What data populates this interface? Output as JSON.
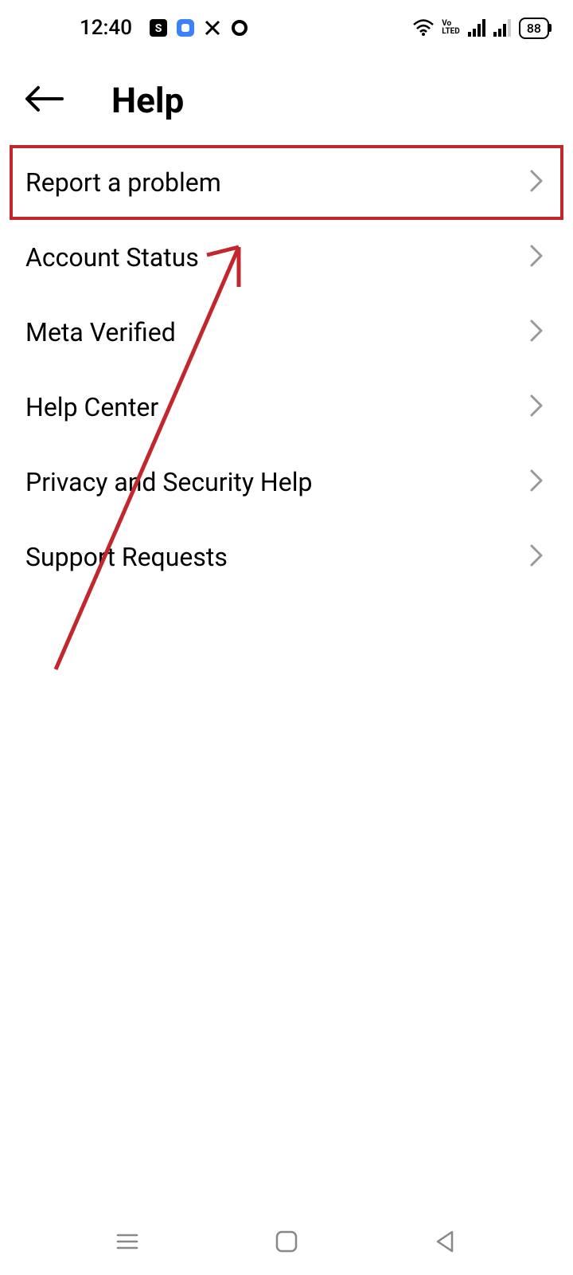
{
  "status_bar": {
    "time": "12:40",
    "battery": "88",
    "volte": "Vo\nLTED"
  },
  "header": {
    "title": "Help"
  },
  "menu": {
    "items": [
      {
        "label": "Report a problem",
        "highlighted": true
      },
      {
        "label": "Account Status",
        "highlighted": false
      },
      {
        "label": "Meta Verified",
        "highlighted": false
      },
      {
        "label": "Help Center",
        "highlighted": false
      },
      {
        "label": "Privacy and Security Help",
        "highlighted": false
      },
      {
        "label": "Support Requests",
        "highlighted": false
      }
    ]
  },
  "annotation": {
    "highlight_color": "#c1272d"
  }
}
